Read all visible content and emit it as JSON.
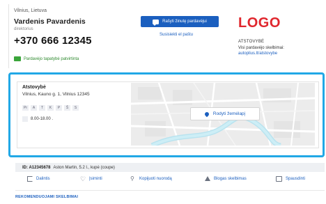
{
  "seller": {
    "city": "Vilnius, Lietuva",
    "name": "Vardenis Pavardenis",
    "role": "direktorius",
    "phone": "+370 666 12345",
    "verified_label": "Pardavėjo tapatybė patvirtinta"
  },
  "contact": {
    "write_button_label": "Rašyti žinutę pardavėjui",
    "email_link_label": "Susisiekti el paštu"
  },
  "dealer": {
    "logo_text": "LOGO",
    "type_label": "ATSTOVYBĖ",
    "all_ads_label": "Visi pardavėjo skelbimai:",
    "all_ads_link": "autoplius.lt/atstovybe"
  },
  "location": {
    "title": "Atstovybė",
    "address": "Vilnius, Kauno g. 1, Vilnius 12345",
    "days": [
      "Pr",
      "A",
      "T",
      "K",
      "P",
      "Š",
      "S"
    ],
    "hours": "8.00-18.00 .",
    "map_button_label": "Rodyti žemėlapį"
  },
  "listing": {
    "id_label": "ID: A12345678",
    "model": "Aston Martin, 5.2 l., kupė (coupe)"
  },
  "actions": {
    "share": "Dalintis",
    "save": "Įsiminti",
    "copy_link": "Kopijuoti nuorodą",
    "report": "Blogas skelbimas",
    "print": "Spausdinti"
  },
  "recommended_label": "REKOMENDUOJAMI SKELBIMAI",
  "colors": {
    "accent_blue": "#1b5fbf",
    "highlight_border": "#21a8e6",
    "logo_red": "#e0262d",
    "verified_green": "#3aa53a"
  }
}
